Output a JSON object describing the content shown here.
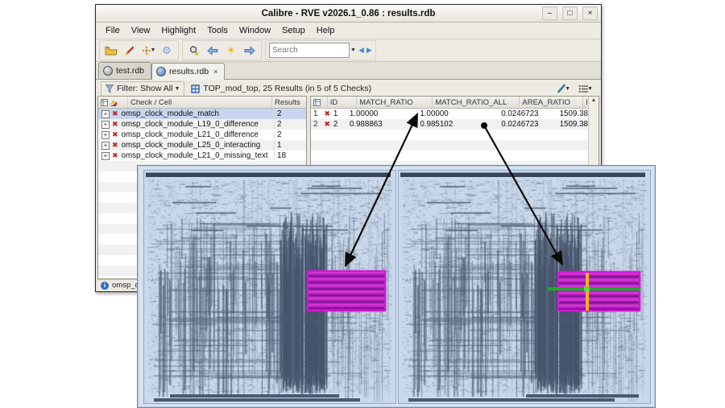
{
  "window": {
    "title": "Calibre - RVE v2026.1_0.86 : results.rdb",
    "controls": {
      "minimize": "–",
      "maximize": "□",
      "close": "×"
    },
    "menu": [
      "File",
      "View",
      "Highlight",
      "Tools",
      "Window",
      "Setup",
      "Help"
    ],
    "toolbar": {
      "search_placeholder": "Search"
    },
    "tabs": [
      {
        "label": "test.rdb"
      },
      {
        "label": "results.rdb",
        "close": "×"
      }
    ],
    "filter": {
      "label": "Filter: Show All",
      "summary": "TOP_mod_top, 25 Results (in 5 of 5 Checks)"
    },
    "checks": {
      "header_check": "Check / Cell",
      "header_results": "Results",
      "rows": [
        {
          "name": "omsp_clock_module_match",
          "results": "2"
        },
        {
          "name": "omsp_clock_module_L19_0_difference",
          "results": "2"
        },
        {
          "name": "omsp_clock_module_L21_0_difference",
          "results": "2"
        },
        {
          "name": "omsp_clock_module_L25_0_interacting",
          "results": "1"
        },
        {
          "name": "omsp_clock_module_L21_0_missing_text",
          "results": "18"
        }
      ]
    },
    "results_table": {
      "headers": {
        "id": "ID",
        "match_ratio": "MATCH_RATIO",
        "match_ratio_all": "MATCH_RATIO_ALL",
        "area_ratio": "AREA_RATIO",
        "ip_ar": "IP_AR"
      },
      "rows": [
        {
          "num": "1",
          "id": "1",
          "match_ratio": "1.00000",
          "match_ratio_all": "1.00000",
          "area_ratio": "0.0246723",
          "ip_ar": "1509.38"
        },
        {
          "num": "2",
          "id": "2",
          "match_ratio": "0.988863",
          "match_ratio_all": "0.985102",
          "area_ratio": "0.0246723",
          "ip_ar": "1509.38"
        }
      ]
    },
    "status_text": "omsp_clo"
  },
  "layout_viewer": {
    "background": "#c9d8ea",
    "highlight_color": "#d218d2",
    "marker_green": "#23a826",
    "marker_yellow": "#f0b41e",
    "views": [
      {
        "name": "layout-view-left",
        "highlight": "match-region"
      },
      {
        "name": "layout-view-right",
        "highlight": "match-region-with-crosshair"
      }
    ]
  }
}
